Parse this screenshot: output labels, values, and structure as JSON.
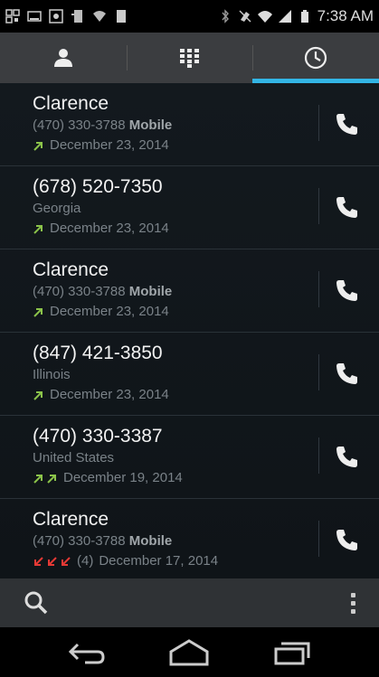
{
  "status_bar": {
    "time": "7:38 AM"
  },
  "tabs": [
    {
      "icon": "person-icon",
      "active": false
    },
    {
      "icon": "dialpad-icon",
      "active": false
    },
    {
      "icon": "clock-icon",
      "active": true
    }
  ],
  "calls": [
    {
      "name": "Clarence",
      "number": "(470) 330-3788",
      "label": "Mobile",
      "location": "",
      "count": "",
      "date": "December 23, 2014",
      "arrows": [
        "outgoing"
      ]
    },
    {
      "name": "(678) 520-7350",
      "number": "",
      "label": "",
      "location": "Georgia",
      "count": "",
      "date": "December 23, 2014",
      "arrows": [
        "outgoing"
      ]
    },
    {
      "name": "Clarence",
      "number": "(470) 330-3788",
      "label": "Mobile",
      "location": "",
      "count": "",
      "date": "December 23, 2014",
      "arrows": [
        "outgoing"
      ]
    },
    {
      "name": "(847) 421-3850",
      "number": "",
      "label": "",
      "location": "Illinois",
      "count": "",
      "date": "December 23, 2014",
      "arrows": [
        "outgoing"
      ]
    },
    {
      "name": "(470) 330-3387",
      "number": "",
      "label": "",
      "location": "United States",
      "count": "",
      "date": "December 19, 2014",
      "arrows": [
        "outgoing",
        "outgoing"
      ]
    },
    {
      "name": "Clarence",
      "number": "(470) 330-3788",
      "label": "Mobile",
      "location": "",
      "count": "(4)",
      "date": "December 17, 2014",
      "arrows": [
        "missed",
        "missed",
        "missed"
      ]
    }
  ],
  "colors": {
    "accent": "#33b5e5",
    "outgoing": "#8bc34a",
    "missed": "#e53935"
  }
}
